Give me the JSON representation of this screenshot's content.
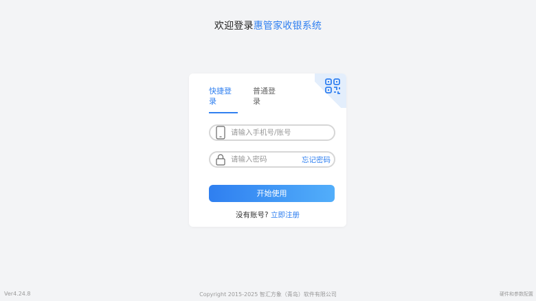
{
  "header": {
    "title_prefix": "欢迎登录",
    "title_brand": "惠管家收银系统"
  },
  "login_card": {
    "qr_toggle_icon": "qr-code-icon",
    "tabs": [
      {
        "label": "快捷登录",
        "active": true
      },
      {
        "label": "普通登录",
        "active": false
      }
    ],
    "phone_field": {
      "icon": "phone-icon",
      "placeholder": "请输入手机号/账号",
      "value": ""
    },
    "password_field": {
      "icon": "lock-icon",
      "placeholder": "请输入密码",
      "value": "",
      "forgot_label": "忘记密码"
    },
    "submit_label": "开始使用",
    "register_prompt": "没有账号?",
    "register_link": "立即注册"
  },
  "footer": {
    "version": "Ver4.24.8",
    "copyright": "Copyright 2015-2025 智汇方象（青岛）软件有限公司",
    "hardware_config": "硬件和参数配置"
  },
  "colors": {
    "accent": "#2f7ff0",
    "background": "#f3f4f6",
    "card": "#ffffff",
    "button_gradient_end": "#52aefa"
  }
}
